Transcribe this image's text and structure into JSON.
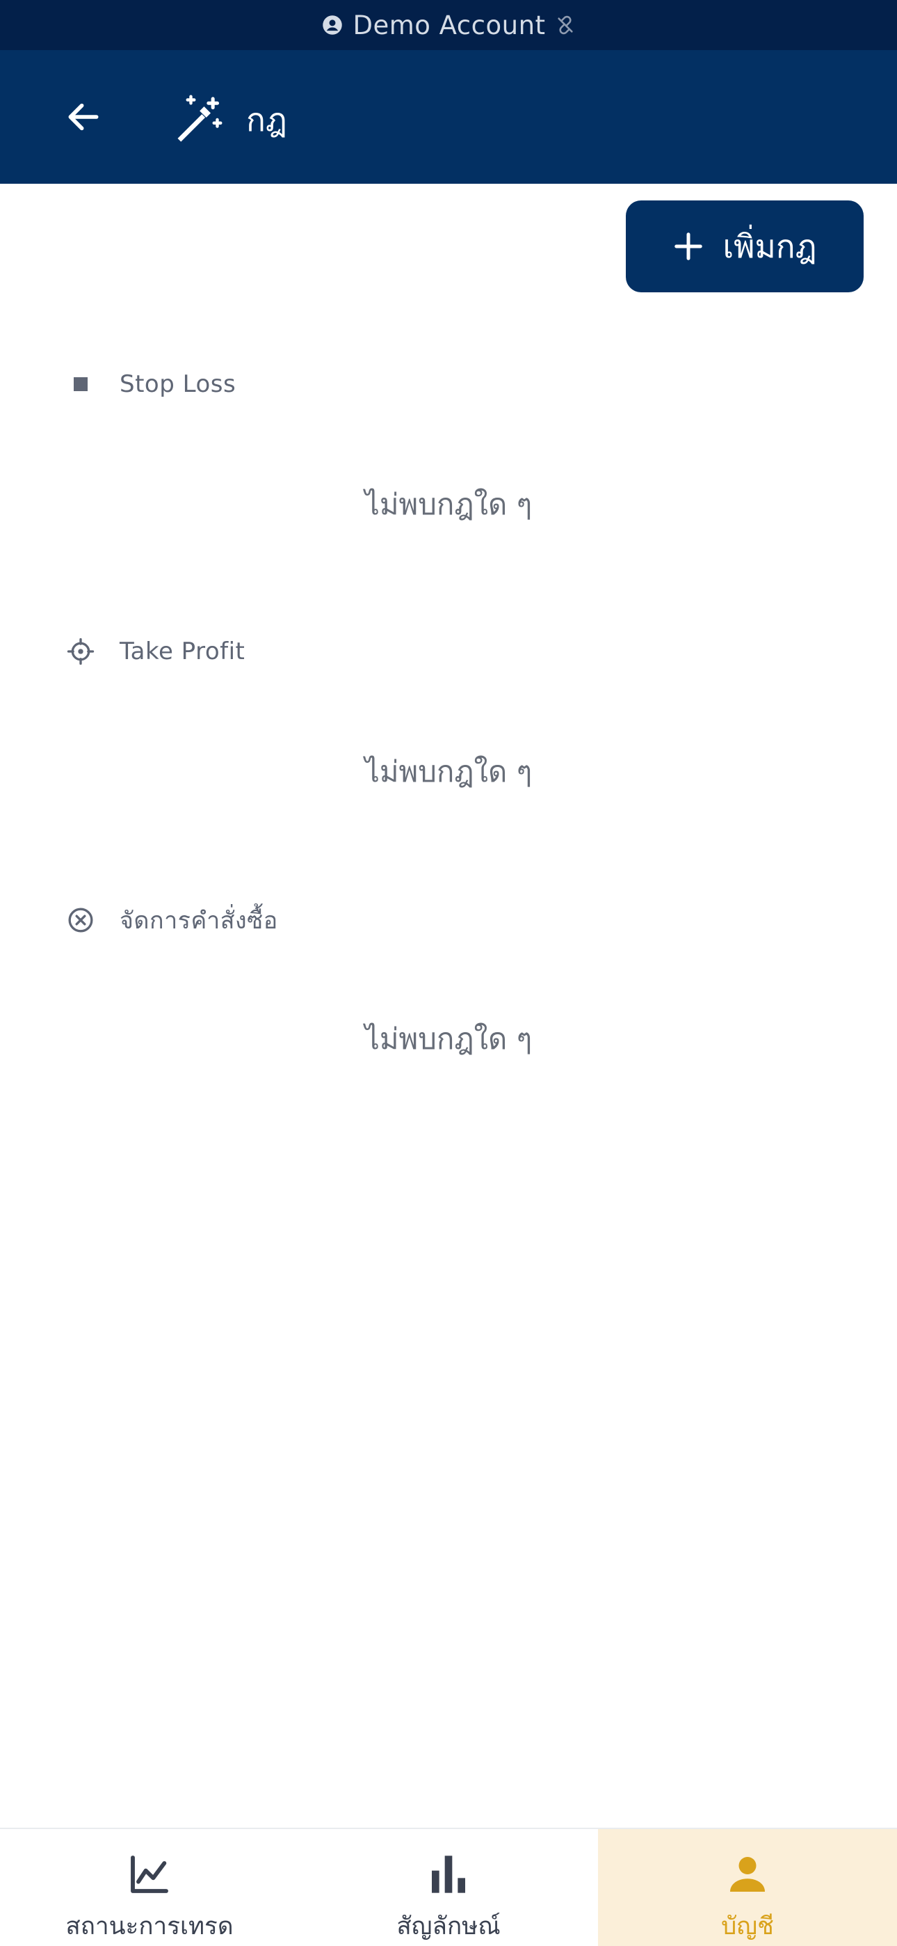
{
  "status_bar": {
    "account_label": "Demo Account",
    "icons": [
      "account-circle-icon",
      "link-off-icon"
    ]
  },
  "app_bar": {
    "title": "กฎ",
    "icons": [
      "arrow-back-icon",
      "magic-wand-icon"
    ]
  },
  "actions": {
    "add_rule_label": "เพิ่มกฎ",
    "icon": "plus-icon"
  },
  "sections": [
    {
      "title": "Stop Loss",
      "icon": "square-stop-icon",
      "empty_text": "ไม่พบกฎใด ๆ"
    },
    {
      "title": "Take Profit",
      "icon": "crosshair-icon",
      "empty_text": "ไม่พบกฎใด ๆ"
    },
    {
      "title": "จัดการคำสั่งซื้อ",
      "icon": "cancel-circle-icon",
      "empty_text": "ไม่พบกฎใด ๆ"
    }
  ],
  "bottom_nav": {
    "items": [
      {
        "label": "สถานะการเทรด",
        "icon": "line-chart-icon",
        "active": false
      },
      {
        "label": "สัญลักษณ์",
        "icon": "bar-chart-icon",
        "active": false
      },
      {
        "label": "บัญชี",
        "icon": "person-icon",
        "active": true
      }
    ]
  },
  "colors": {
    "status_bar_bg": "#03204a",
    "app_bar_bg": "#033063",
    "accent": "#d9a21b",
    "active_tab_bg": "#fbefd9"
  }
}
